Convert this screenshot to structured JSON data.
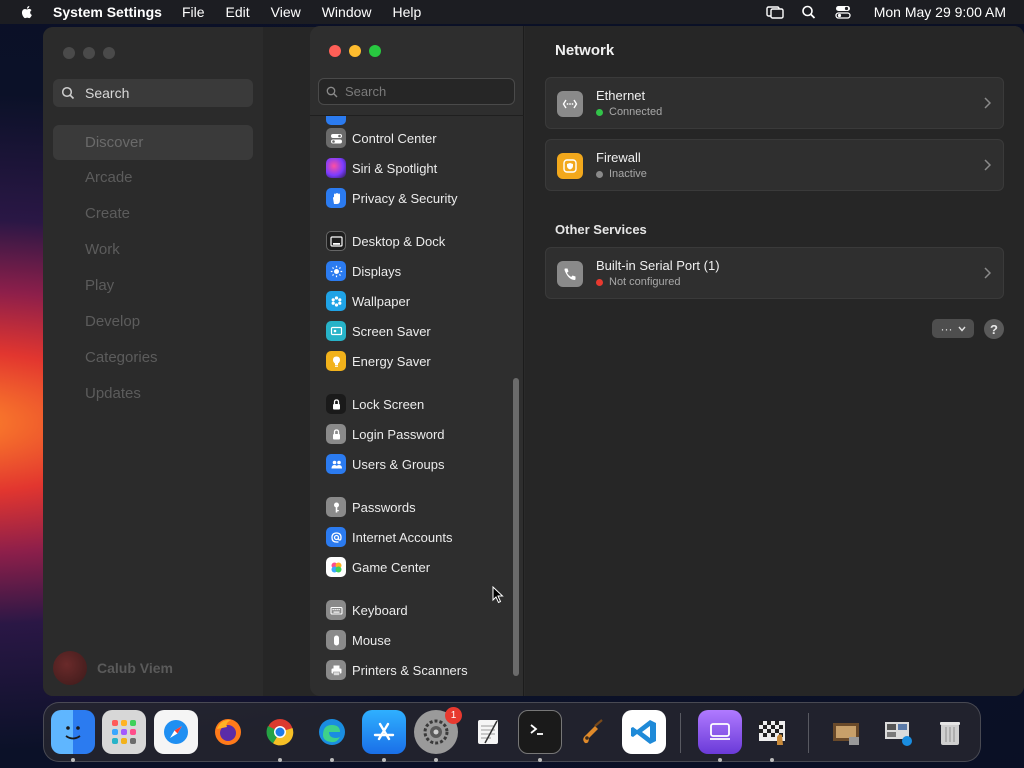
{
  "menubar": {
    "app_name": "System Settings",
    "menus": [
      "File",
      "Edit",
      "View",
      "Window",
      "Help"
    ],
    "clock": "Mon May 29  9:00 AM"
  },
  "appstore": {
    "search_placeholder": "Search",
    "nav": [
      "Discover",
      "Arcade",
      "Create",
      "Work",
      "Play",
      "Develop",
      "Categories",
      "Updates"
    ],
    "selected_nav": "Discover",
    "user_name": "Calub Viem"
  },
  "settings": {
    "search_placeholder": "Search",
    "sidebar_items": [
      {
        "label": "Control Center",
        "icon": "control-center-icon",
        "color": "#6b6b6b"
      },
      {
        "label": "Siri & Spotlight",
        "icon": "siri-icon",
        "color": "#8a3ccf"
      },
      {
        "label": "Privacy & Security",
        "icon": "hand-icon",
        "color": "#2b7bf0"
      },
      {
        "label": "Desktop & Dock",
        "icon": "dock-icon",
        "color": "#3a3a3a"
      },
      {
        "label": "Displays",
        "icon": "sun-icon",
        "color": "#2b7bf0"
      },
      {
        "label": "Wallpaper",
        "icon": "wallpaper-icon",
        "color": "#1fa3e6"
      },
      {
        "label": "Screen Saver",
        "icon": "screen-saver-icon",
        "color": "#27b3c8"
      },
      {
        "label": "Energy Saver",
        "icon": "battery-icon",
        "color": "#f2b21b"
      },
      {
        "label": "Lock Screen",
        "icon": "lock-icon",
        "color": "#2a2a2a"
      },
      {
        "label": "Login Password",
        "icon": "padlock-icon",
        "color": "#8a8a8a"
      },
      {
        "label": "Users & Groups",
        "icon": "users-icon",
        "color": "#2b7bf0"
      },
      {
        "label": "Passwords",
        "icon": "key-icon",
        "color": "#8a8a8a"
      },
      {
        "label": "Internet Accounts",
        "icon": "at-icon",
        "color": "#2b7bf0"
      },
      {
        "label": "Game Center",
        "icon": "game-center-icon",
        "color": "#ffffff"
      },
      {
        "label": "Keyboard",
        "icon": "keyboard-icon",
        "color": "#8a8a8a"
      },
      {
        "label": "Mouse",
        "icon": "mouse-icon",
        "color": "#8a8a8a"
      },
      {
        "label": "Printers & Scanners",
        "icon": "printer-icon",
        "color": "#8a8a8a"
      }
    ],
    "title": "Network",
    "services": [
      {
        "name": "Ethernet",
        "status": "Connected",
        "status_color": "#32c349",
        "icon": "ethernet-icon"
      },
      {
        "name": "Firewall",
        "status": "Inactive",
        "status_color": "#8a8a8a",
        "icon": "firewall-icon"
      }
    ],
    "other_services_title": "Other Services",
    "other_services": [
      {
        "name": "Built-in Serial Port (1)",
        "status": "Not configured",
        "status_color": "#e8392f",
        "icon": "phone-icon"
      }
    ],
    "action_label": "···",
    "help_label": "?"
  },
  "dock": {
    "badge_count": "1"
  }
}
